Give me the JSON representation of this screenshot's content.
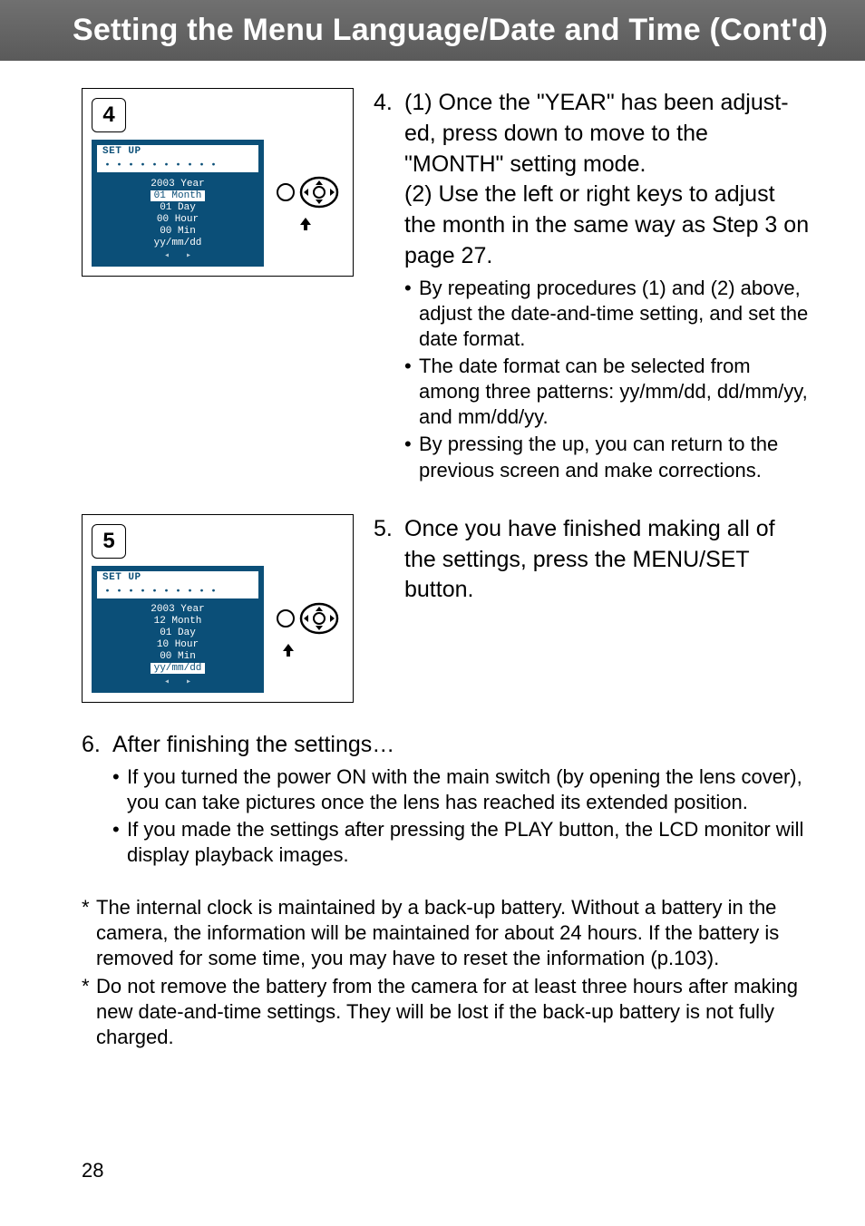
{
  "header": {
    "title": "Setting the Menu Language/Date and Time (Cont'd)"
  },
  "fig4": {
    "num": "4",
    "setup_label": "SET UP",
    "lines": {
      "year": "2003 Year",
      "month": "01 Month",
      "day": "01 Day",
      "hour": "00 Hour",
      "min": "00 Min",
      "fmt": "yy/mm/dd"
    }
  },
  "fig5": {
    "num": "5",
    "setup_label": "SET UP",
    "lines": {
      "year": "2003 Year",
      "month": "12 Month",
      "day": "01 Day",
      "hour": "10 Hour",
      "min": "00 Min",
      "fmt": "yy/mm/dd"
    }
  },
  "step4": {
    "num": "4.",
    "p1": "(1) Once the \"YEAR\" has been adjust­ed, press down to move to the \"MONTH\" setting mode.",
    "p2": "(2) Use the left or right keys to adjust the month in the same way as Step 3 on page 27.",
    "b1": "By repeating procedures (1) and (2) above, adjust the date-and-time setting, and set the date format.",
    "b2": "The date format can be selected from among three patterns: yy/mm/dd, dd/mm/yy, and mm/dd/yy.",
    "b3": "By pressing the up, you can return to the previous screen and make corrections."
  },
  "step5": {
    "num": "5.",
    "p1": "Once you have finished making all of the settings, press the MENU/SET button."
  },
  "step6": {
    "num": "6.",
    "title": "After finishing the settings…",
    "b1": "If you turned the power ON with the main switch (by opening the lens cover), you can take pictures once the lens has reached its extended position.",
    "b2": "If you made the settings after pressing the PLAY button, the LCD monitor will display playback images."
  },
  "notes": {
    "n1": "The internal clock is maintained by a back-up battery. Without a battery in the camera, the information will be maintained for about 24 hours. If the battery is removed for some time, you may have to reset the information (p.103).",
    "n2": "Do not remove the battery from the camera for at least three hours after mak­ing new date-and-time settings. They will be lost if the back-up battery is not fully charged."
  },
  "page": "28"
}
